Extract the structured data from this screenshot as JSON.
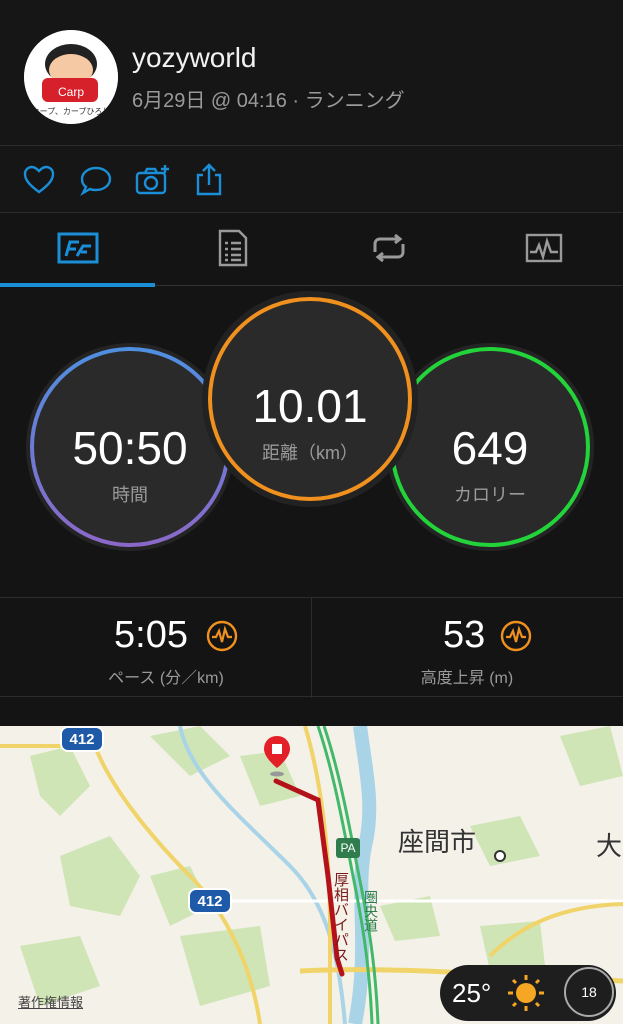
{
  "header": {
    "username": "yozyworld",
    "meta": "6月29日 @ 04:16 · ランニング",
    "avatar_icon": "cartoon-avatar"
  },
  "actions": [
    "heart-icon",
    "comment-icon",
    "camera-icon",
    "share-icon"
  ],
  "tabs": [
    {
      "icon": "activity-summary-icon",
      "active": true
    },
    {
      "icon": "details-list-icon",
      "active": false
    },
    {
      "icon": "laps-loop-icon",
      "active": false
    },
    {
      "icon": "chart-graph-icon",
      "active": false
    }
  ],
  "rings": {
    "time": {
      "value": "50:50",
      "label": "時間"
    },
    "distance": {
      "value": "10.01",
      "label": "距離（km）"
    },
    "calories": {
      "value": "649",
      "label": "カロリー"
    }
  },
  "stats": {
    "pace": {
      "value": "5:05",
      "label": "ペース (分／km)"
    },
    "elevation": {
      "value": "53",
      "label": "高度上昇 (m)"
    }
  },
  "map": {
    "route_badge_1": "412",
    "route_badge_2": "412",
    "city": "座間市",
    "city_partial": "大",
    "road_label_1": "厚相バイパス",
    "road_label_2": "圏央道",
    "pa_label": "PA",
    "copyright": "著作権情報",
    "temperature": "25°",
    "compass_value": "18"
  },
  "colors": {
    "accent_blue": "#1a8fd8",
    "ring_orange": "#f0901e",
    "ring_green": "#22d33a",
    "ring_blue_start": "#4f8fe0",
    "ring_blue_end": "#8b68c8",
    "route_red": "#b3121b"
  }
}
